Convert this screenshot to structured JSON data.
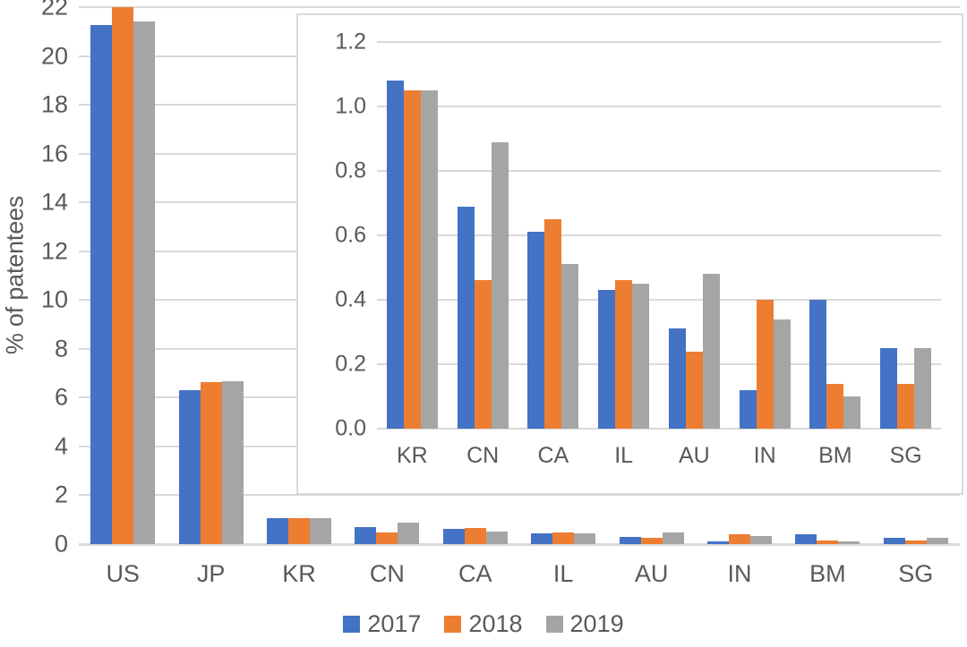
{
  "chart_data": [
    {
      "id": "main",
      "type": "bar",
      "title": "",
      "xlabel": "",
      "ylabel": "% of patentees",
      "ylim": [
        0,
        22
      ],
      "yticks": [
        0,
        2,
        4,
        6,
        8,
        10,
        12,
        14,
        16,
        18,
        20,
        22
      ],
      "grid": true,
      "legend_position": "bottom",
      "categories": [
        "US",
        "JP",
        "KR",
        "CN",
        "CA",
        "IL",
        "AU",
        "IN",
        "BM",
        "SG"
      ],
      "series": [
        {
          "name": "2017",
          "color": "#4472C4",
          "values": [
            21.25,
            6.32,
            1.08,
            0.69,
            0.61,
            0.43,
            0.31,
            0.12,
            0.4,
            0.25
          ]
        },
        {
          "name": "2018",
          "color": "#ED7D31",
          "values": [
            22.0,
            6.65,
            1.05,
            0.46,
            0.65,
            0.46,
            0.24,
            0.4,
            0.14,
            0.14
          ]
        },
        {
          "name": "2019",
          "color": "#A5A5A5",
          "values": [
            21.4,
            6.68,
            1.05,
            0.89,
            0.51,
            0.45,
            0.48,
            0.34,
            0.1,
            0.25
          ]
        }
      ]
    },
    {
      "id": "inset",
      "type": "bar",
      "title": "",
      "xlabel": "",
      "ylabel": "",
      "ylim": [
        0,
        1.2
      ],
      "yticks": [
        "0.0",
        "0.2",
        "0.4",
        "0.6",
        "0.8",
        "1.0",
        "1.2"
      ],
      "ytick_values": [
        0.0,
        0.2,
        0.4,
        0.6,
        0.8,
        1.0,
        1.2
      ],
      "grid": true,
      "categories": [
        "KR",
        "CN",
        "CA",
        "IL",
        "AU",
        "IN",
        "BM",
        "SG"
      ],
      "series": [
        {
          "name": "2017",
          "color": "#4472C4",
          "values": [
            1.08,
            0.69,
            0.61,
            0.43,
            0.31,
            0.12,
            0.4,
            0.25
          ]
        },
        {
          "name": "2018",
          "color": "#ED7D31",
          "values": [
            1.05,
            0.46,
            0.65,
            0.46,
            0.24,
            0.4,
            0.14,
            0.14
          ]
        },
        {
          "name": "2019",
          "color": "#A5A5A5",
          "values": [
            1.05,
            0.89,
            0.51,
            0.45,
            0.48,
            0.34,
            0.1,
            0.25
          ]
        }
      ]
    }
  ],
  "legend": {
    "items": [
      {
        "label": "2017",
        "color": "#4472C4"
      },
      {
        "label": "2018",
        "color": "#ED7D31"
      },
      {
        "label": "2019",
        "color": "#A5A5A5"
      }
    ]
  },
  "axis": {
    "main_y_title": "% of patentees"
  }
}
